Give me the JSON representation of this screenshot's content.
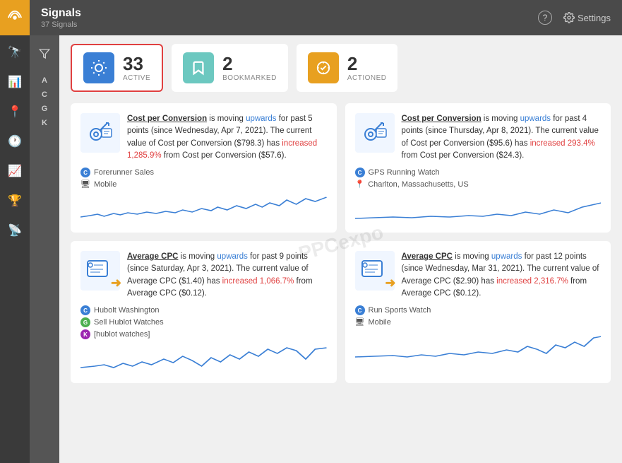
{
  "leftNav": {
    "brandIcon": "📡",
    "icons": [
      "🔭",
      "📊",
      "📍",
      "🕐",
      "📈",
      "🏆",
      "📡"
    ]
  },
  "header": {
    "title": "Signals",
    "subtitle": "37 Signals",
    "helpLabel": "?",
    "settingsLabel": "Settings"
  },
  "secondaryNav": {
    "filterIcon": "⊟",
    "alphaLabels": [
      "A",
      "C",
      "G",
      "K"
    ]
  },
  "statsRow": {
    "active": {
      "iconLabel": "💡",
      "count": "33",
      "label": "Active"
    },
    "bookmarked": {
      "iconLabel": "🔖",
      "count": "2",
      "label": "Bookmarked"
    },
    "actioned": {
      "iconLabel": "✦",
      "count": "2",
      "label": "Actioned"
    }
  },
  "cards": [
    {
      "id": "card-1",
      "textParts": [
        {
          "type": "bold-underline",
          "text": "Cost per Conversion"
        },
        {
          "type": "normal",
          "text": " is moving "
        },
        {
          "type": "blue",
          "text": "upwards"
        },
        {
          "type": "normal",
          "text": " for past 5 points (since Wednesday, Apr 7, 2021). The current value of Cost per Conversion ($798.3) has "
        },
        {
          "type": "red",
          "text": "increased 1,285.9%"
        },
        {
          "type": "normal",
          "text": " from Cost per Conversion ($57.6)."
        }
      ],
      "meta": [
        {
          "badge": "C",
          "badgeClass": "badge-c",
          "text": "Forerunner Sales",
          "icon": "C"
        },
        {
          "badge": "📱",
          "badgeClass": "",
          "text": "Mobile",
          "icon": "mobile"
        }
      ],
      "chartId": "chart1"
    },
    {
      "id": "card-2",
      "textParts": [
        {
          "type": "bold-underline",
          "text": "Cost per Conversion"
        },
        {
          "type": "normal",
          "text": " is moving "
        },
        {
          "type": "blue",
          "text": "upwards"
        },
        {
          "type": "normal",
          "text": " for past 4 points (since Thursday, Apr 8, 2021). The current value of Cost per Conversion ($95.6) has "
        },
        {
          "type": "red",
          "text": "increased 293.4%"
        },
        {
          "type": "normal",
          "text": " from Cost per Conversion ($24.3)."
        }
      ],
      "meta": [
        {
          "badge": "C",
          "badgeClass": "badge-c",
          "text": "GPS Running Watch",
          "icon": "C"
        },
        {
          "badge": "📍",
          "badgeClass": "",
          "text": "Charlton, Massachusetts, US",
          "icon": "location"
        }
      ],
      "chartId": "chart2"
    },
    {
      "id": "card-3",
      "textParts": [
        {
          "type": "bold-underline",
          "text": "Average CPC"
        },
        {
          "type": "normal",
          "text": " is moving "
        },
        {
          "type": "blue",
          "text": "upwards"
        },
        {
          "type": "normal",
          "text": " for past 9 points (since Saturday, Apr 3, 2021). The current value of Average CPC ($1.40) has "
        },
        {
          "type": "red",
          "text": "increased 1,066.7%"
        },
        {
          "type": "normal",
          "text": " from Average CPC ($0.12)."
        }
      ],
      "meta": [
        {
          "badge": "C",
          "badgeClass": "badge-c",
          "text": "Hubolt Washington",
          "icon": "C"
        },
        {
          "badge": "G",
          "badgeClass": "badge-g",
          "text": "Sell Hublot Watches",
          "icon": "G"
        },
        {
          "badge": "K",
          "badgeClass": "badge-k",
          "text": "[hublot watches]",
          "icon": "K"
        }
      ],
      "chartId": "chart3"
    },
    {
      "id": "card-4",
      "textParts": [
        {
          "type": "bold-underline",
          "text": "Average CPC"
        },
        {
          "type": "normal",
          "text": " is moving "
        },
        {
          "type": "blue",
          "text": "upwards"
        },
        {
          "type": "normal",
          "text": " for past 12 points (since Wednesday, Mar 31, 2021). The current value of Average CPC ($2.90) has "
        },
        {
          "type": "red",
          "text": "increased 2,316.7%"
        },
        {
          "type": "normal",
          "text": " from Average CPC ($0.12)."
        }
      ],
      "meta": [
        {
          "badge": "C",
          "badgeClass": "badge-c",
          "text": "Run Sports Watch",
          "icon": "C"
        },
        {
          "badge": "📱",
          "badgeClass": "",
          "text": "Mobile",
          "icon": "mobile"
        }
      ],
      "chartId": "chart4"
    }
  ],
  "watermark": "PPCexpo"
}
